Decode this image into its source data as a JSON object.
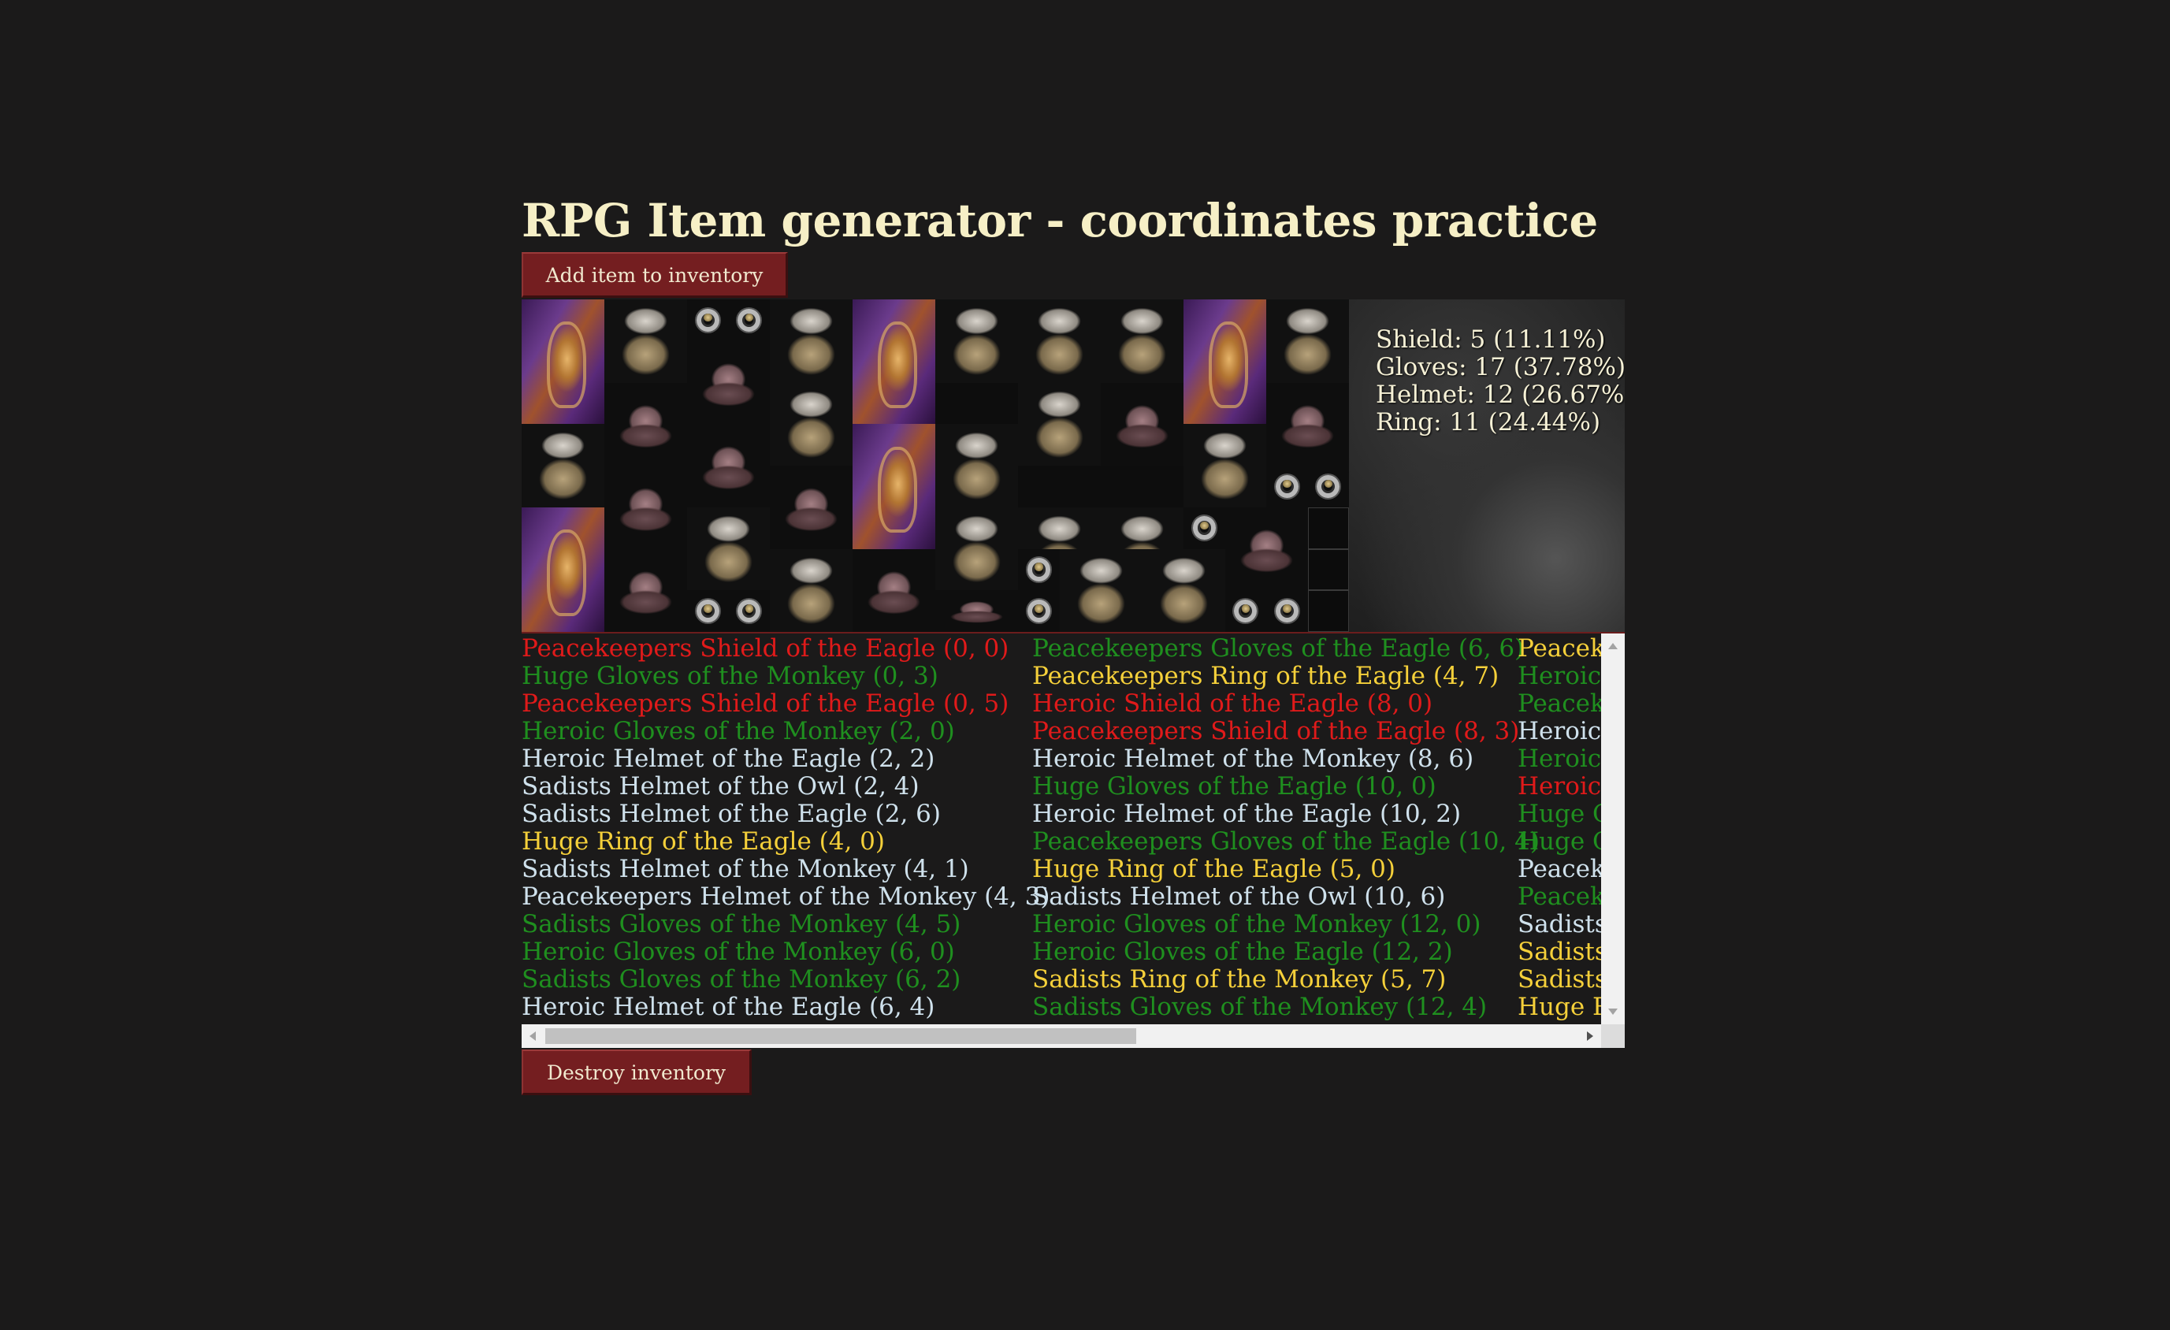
{
  "page": {
    "title": "RPG Item generator - coordinates practice",
    "add_button_label": "Add item to inventory",
    "destroy_button_label": "Destroy inventory"
  },
  "icons": {
    "Shield": "shield-icon",
    "Gloves": "gloves-icon",
    "Helmet": "helmet-icon",
    "Ring": "ring-icon"
  },
  "colors": {
    "Shield": "#e01a1a",
    "Gloves": "#1f8f1f",
    "Helmet": "#cfe1ec",
    "Ring": "#f5d03a",
    "button": "#741e20"
  },
  "grid": {
    "cols": 10,
    "rows": 8,
    "items": [
      {
        "type": "Shield",
        "x": 0,
        "y": 0,
        "w": 2,
        "h": 3
      },
      {
        "type": "Gloves",
        "x": 2,
        "y": 0,
        "w": 2,
        "h": 2
      },
      {
        "type": "Ring",
        "x": 4,
        "y": 0,
        "w": 1,
        "h": 1
      },
      {
        "type": "Ring",
        "x": 5,
        "y": 0,
        "w": 1,
        "h": 1
      },
      {
        "type": "Gloves",
        "x": 6,
        "y": 0,
        "w": 2,
        "h": 2
      },
      {
        "type": "Shield",
        "x": 8,
        "y": 0,
        "w": 2,
        "h": 3
      },
      {
        "type": "Gloves",
        "x": 10,
        "y": 0,
        "w": 2,
        "h": 2
      },
      {
        "type": "Gloves",
        "x": 12,
        "y": 0,
        "w": 2,
        "h": 2
      },
      {
        "type": "Gloves",
        "x": 14,
        "y": 0,
        "w": 2,
        "h": 2
      },
      {
        "type": "Shield",
        "x": 16,
        "y": 0,
        "w": 2,
        "h": 3
      },
      {
        "type": "Gloves",
        "x": 18,
        "y": 0,
        "w": 2,
        "h": 2
      },
      {
        "type": "Helmet",
        "x": 4,
        "y": 1,
        "w": 2,
        "h": 2
      },
      {
        "type": "Helmet",
        "x": 2,
        "y": 2,
        "w": 2,
        "h": 2
      },
      {
        "type": "Gloves",
        "x": 6,
        "y": 2,
        "w": 2,
        "h": 2
      },
      {
        "type": "Helmet",
        "x": 14,
        "y": 2,
        "w": 2,
        "h": 2
      },
      {
        "type": "Gloves",
        "x": 12,
        "y": 2,
        "w": 2,
        "h": 2
      },
      {
        "type": "Helmet",
        "x": 18,
        "y": 2,
        "w": 2,
        "h": 2
      },
      {
        "type": "Gloves",
        "x": 0,
        "y": 3,
        "w": 2,
        "h": 2
      },
      {
        "type": "Helmet",
        "x": 4,
        "y": 3,
        "w": 2,
        "h": 2
      },
      {
        "type": "Shield",
        "x": 8,
        "y": 3,
        "w": 2,
        "h": 3
      },
      {
        "type": "Gloves",
        "x": 10,
        "y": 3,
        "w": 2,
        "h": 2
      },
      {
        "type": "Gloves",
        "x": 16,
        "y": 3,
        "w": 2,
        "h": 2
      },
      {
        "type": "Helmet",
        "x": 2,
        "y": 4,
        "w": 2,
        "h": 2
      },
      {
        "type": "Helmet",
        "x": 6,
        "y": 4,
        "w": 2,
        "h": 2
      },
      {
        "type": "Ring",
        "x": 18,
        "y": 4,
        "w": 1,
        "h": 1
      },
      {
        "type": "Ring",
        "x": 19,
        "y": 4,
        "w": 1,
        "h": 1
      },
      {
        "type": "Gloves",
        "x": 10,
        "y": 5,
        "w": 2,
        "h": 2
      },
      {
        "type": "Gloves",
        "x": 12,
        "y": 5,
        "w": 2,
        "h": 2
      },
      {
        "type": "Gloves",
        "x": 14,
        "y": 5,
        "w": 2,
        "h": 2
      },
      {
        "type": "Ring",
        "x": 16,
        "y": 5,
        "w": 1,
        "h": 1
      },
      {
        "type": "Helmet",
        "x": 17,
        "y": 5,
        "w": 2,
        "h": 2
      },
      {
        "type": "Shield",
        "x": 0,
        "y": 5,
        "w": 2,
        "h": 3
      },
      {
        "type": "Helmet",
        "x": 2,
        "y": 6,
        "w": 2,
        "h": 2
      },
      {
        "type": "Gloves",
        "x": 4,
        "y": 5,
        "w": 2,
        "h": 2
      },
      {
        "type": "Ring",
        "x": 4,
        "y": 7,
        "w": 1,
        "h": 1
      },
      {
        "type": "Ring",
        "x": 5,
        "y": 7,
        "w": 1,
        "h": 1
      },
      {
        "type": "Gloves",
        "x": 6,
        "y": 6,
        "w": 2,
        "h": 2
      },
      {
        "type": "Helmet",
        "x": 8,
        "y": 6,
        "w": 2,
        "h": 2
      },
      {
        "type": "Helmet",
        "x": 10,
        "y": 7,
        "w": 2,
        "h": 1
      },
      {
        "type": "Ring",
        "x": 12,
        "y": 6,
        "w": 1,
        "h": 1
      },
      {
        "type": "Ring",
        "x": 12,
        "y": 7,
        "w": 1,
        "h": 1
      },
      {
        "type": "Gloves",
        "x": 13,
        "y": 6,
        "w": 2,
        "h": 2
      },
      {
        "type": "Gloves",
        "x": 15,
        "y": 6,
        "w": 2,
        "h": 2
      },
      {
        "type": "Ring",
        "x": 17,
        "y": 7,
        "w": 1,
        "h": 1
      },
      {
        "type": "Ring",
        "x": 18,
        "y": 7,
        "w": 1,
        "h": 1
      }
    ],
    "empty_cells": [
      {
        "x": 19,
        "y": 5
      },
      {
        "x": 19,
        "y": 6
      },
      {
        "x": 19,
        "y": 7
      }
    ]
  },
  "stats": [
    {
      "type": "Shield",
      "text": "Shield: 5 (11.11%)"
    },
    {
      "type": "Gloves",
      "text": "Gloves: 17 (37.78%)"
    },
    {
      "type": "Helmet",
      "text": "Helmet: 12 (26.67%)"
    },
    {
      "type": "Ring",
      "text": "Ring: 11 (24.44%)"
    }
  ],
  "log": {
    "columns": [
      [
        {
          "type": "Shield",
          "text": "Peacekeepers Shield of the Eagle (0, 0)"
        },
        {
          "type": "Gloves",
          "text": "Huge Gloves of the Monkey (0, 3)"
        },
        {
          "type": "Shield",
          "text": "Peacekeepers Shield of the Eagle (0, 5)"
        },
        {
          "type": "Gloves",
          "text": "Heroic Gloves of the Monkey (2, 0)"
        },
        {
          "type": "Helmet",
          "text": "Heroic Helmet of the Eagle (2, 2)"
        },
        {
          "type": "Helmet",
          "text": "Sadists Helmet of the Owl (2, 4)"
        },
        {
          "type": "Helmet",
          "text": "Sadists Helmet of the Eagle (2, 6)"
        },
        {
          "type": "Ring",
          "text": "Huge Ring of the Eagle (4, 0)"
        },
        {
          "type": "Helmet",
          "text": "Sadists Helmet of the Monkey (4, 1)"
        },
        {
          "type": "Helmet",
          "text": "Peacekeepers Helmet of the Monkey (4, 3)"
        },
        {
          "type": "Gloves",
          "text": "Sadists Gloves of the Monkey (4, 5)"
        },
        {
          "type": "Gloves",
          "text": "Heroic Gloves of the Monkey (6, 0)"
        },
        {
          "type": "Gloves",
          "text": "Sadists Gloves of the Monkey (6, 2)"
        },
        {
          "type": "Helmet",
          "text": "Heroic Helmet of the Eagle (6, 4)"
        }
      ],
      [
        {
          "type": "Gloves",
          "text": "Peacekeepers Gloves of the Eagle (6, 6)"
        },
        {
          "type": "Ring",
          "text": "Peacekeepers Ring of the Eagle (4, 7)"
        },
        {
          "type": "Shield",
          "text": "Heroic Shield of the Eagle (8, 0)"
        },
        {
          "type": "Shield",
          "text": "Peacekeepers Shield of the Eagle (8, 3)"
        },
        {
          "type": "Helmet",
          "text": "Heroic Helmet of the Monkey (8, 6)"
        },
        {
          "type": "Gloves",
          "text": "Huge Gloves of the Eagle (10, 0)"
        },
        {
          "type": "Helmet",
          "text": "Heroic Helmet of the Eagle (10, 2)"
        },
        {
          "type": "Gloves",
          "text": "Peacekeepers Gloves of the Eagle (10, 4)"
        },
        {
          "type": "Ring",
          "text": "Huge Ring of the Eagle (5, 0)"
        },
        {
          "type": "Helmet",
          "text": "Sadists Helmet of the Owl (10, 6)"
        },
        {
          "type": "Gloves",
          "text": "Heroic Gloves of the Monkey (12, 0)"
        },
        {
          "type": "Gloves",
          "text": "Heroic Gloves of the Eagle (12, 2)"
        },
        {
          "type": "Ring",
          "text": "Sadists Ring of the Monkey (5, 7)"
        },
        {
          "type": "Gloves",
          "text": "Sadists Gloves of the Monkey (12, 4)"
        }
      ],
      [
        {
          "type": "Ring",
          "text": "Peaceke"
        },
        {
          "type": "Gloves",
          "text": "Heroic "
        },
        {
          "type": "Gloves",
          "text": "Peaceke"
        },
        {
          "type": "Helmet",
          "text": "Heroic I"
        },
        {
          "type": "Gloves",
          "text": "Heroic "
        },
        {
          "type": "Shield",
          "text": "Heroic "
        },
        {
          "type": "Gloves",
          "text": "Huge G"
        },
        {
          "type": "Gloves",
          "text": "Huge G"
        },
        {
          "type": "Helmet",
          "text": "Peaceke"
        },
        {
          "type": "Gloves",
          "text": "Peaceke"
        },
        {
          "type": "Helmet",
          "text": "Sadists "
        },
        {
          "type": "Ring",
          "text": "Sadists "
        },
        {
          "type": "Ring",
          "text": "Sadists "
        },
        {
          "type": "Ring",
          "text": "Huge Ri"
        }
      ]
    ]
  }
}
